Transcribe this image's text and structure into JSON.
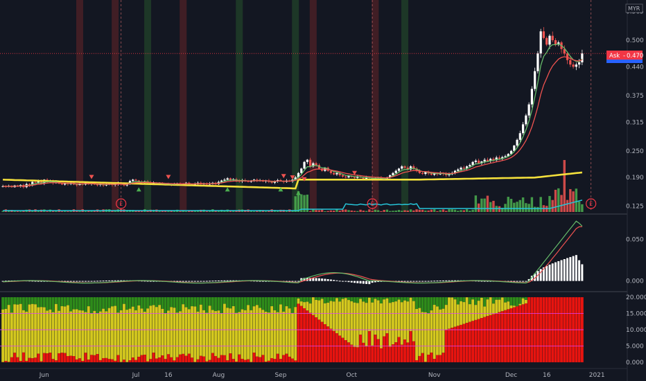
{
  "chart_data": [
    {
      "type": "candlestick",
      "pane": "price",
      "currency": "MYR",
      "y_ticks": [
        "0.565",
        "0.500",
        "0.440",
        "0.375",
        "0.315",
        "0.250",
        "0.190",
        "0.125"
      ],
      "ylim": [
        0.112,
        0.572
      ],
      "x_ticks": [
        "Jun",
        "Jul",
        "16",
        "Aug",
        "Sep",
        "Oct",
        "Nov",
        "Dec",
        "16",
        "2021"
      ],
      "ask_label": "Ask",
      "ask_value": "0.470",
      "earnings_marker": "E",
      "colors": {
        "up": "#26a69a",
        "down": "#ef5350",
        "ema_slow": "#f5e13c",
        "ema_fast": "#66bb6a",
        "ema_mid": "#ef5350",
        "volume_ma": "#26c6da",
        "ask": "#f23645"
      },
      "close": [
        0.17,
        0.169,
        0.171,
        0.168,
        0.172,
        0.17,
        0.173,
        0.168,
        0.175,
        0.172,
        0.18,
        0.178,
        0.182,
        0.176,
        0.185,
        0.18,
        0.183,
        0.177,
        0.18,
        0.176,
        0.174,
        0.177,
        0.175,
        0.178,
        0.174,
        0.173,
        0.176,
        0.174,
        0.178,
        0.175,
        0.177,
        0.174,
        0.173,
        0.175,
        0.172,
        0.174,
        0.176,
        0.173,
        0.175,
        0.177,
        0.174,
        0.172,
        0.175,
        0.182,
        0.185,
        0.183,
        0.18,
        0.178,
        0.181,
        0.179,
        0.176,
        0.178,
        0.175,
        0.177,
        0.175,
        0.174,
        0.176,
        0.173,
        0.175,
        0.177,
        0.174,
        0.176,
        0.178,
        0.175,
        0.174,
        0.176,
        0.178,
        0.175,
        0.177,
        0.174,
        0.176,
        0.178,
        0.175,
        0.18,
        0.183,
        0.185,
        0.188,
        0.184,
        0.186,
        0.183,
        0.181,
        0.184,
        0.182,
        0.18,
        0.183,
        0.185,
        0.182,
        0.184,
        0.181,
        0.183,
        0.18,
        0.178,
        0.181,
        0.184,
        0.182,
        0.18,
        0.183,
        0.181,
        0.185,
        0.19,
        0.2,
        0.21,
        0.225,
        0.23,
        0.215,
        0.222,
        0.218,
        0.21,
        0.205,
        0.212,
        0.205,
        0.2,
        0.197,
        0.2,
        0.195,
        0.192,
        0.19,
        0.193,
        0.191,
        0.189,
        0.192,
        0.19,
        0.187,
        0.19,
        0.188,
        0.186,
        0.188,
        0.19,
        0.187,
        0.185,
        0.19,
        0.195,
        0.2,
        0.205,
        0.21,
        0.215,
        0.212,
        0.208,
        0.215,
        0.21,
        0.205,
        0.2,
        0.198,
        0.202,
        0.199,
        0.196,
        0.199,
        0.197,
        0.2,
        0.198,
        0.195,
        0.197,
        0.2,
        0.205,
        0.208,
        0.212,
        0.21,
        0.215,
        0.218,
        0.225,
        0.228,
        0.222,
        0.226,
        0.23,
        0.227,
        0.232,
        0.229,
        0.235,
        0.232,
        0.236,
        0.238,
        0.243,
        0.25,
        0.262,
        0.275,
        0.29,
        0.31,
        0.33,
        0.355,
        0.39,
        0.43,
        0.47,
        0.52,
        0.505,
        0.49,
        0.51,
        0.5,
        0.49,
        0.495,
        0.48,
        0.47,
        0.455,
        0.445,
        0.44,
        0.445,
        0.45,
        0.47
      ]
    },
    {
      "type": "line",
      "pane": "macd",
      "y_ticks": [
        "0.050",
        "0.000"
      ],
      "ylim": [
        -0.012,
        0.078
      ]
    },
    {
      "type": "bar",
      "pane": "oscillator",
      "y_ticks": [
        "20.000",
        "15.000",
        "10.000",
        "5.000",
        "0.000"
      ],
      "ylim": [
        -1.5,
        21.5
      ],
      "colors": {
        "top": "#2e8b1a",
        "mid": "#d4c81e",
        "low": "#e8140f",
        "hline": "#e040fb"
      }
    }
  ]
}
